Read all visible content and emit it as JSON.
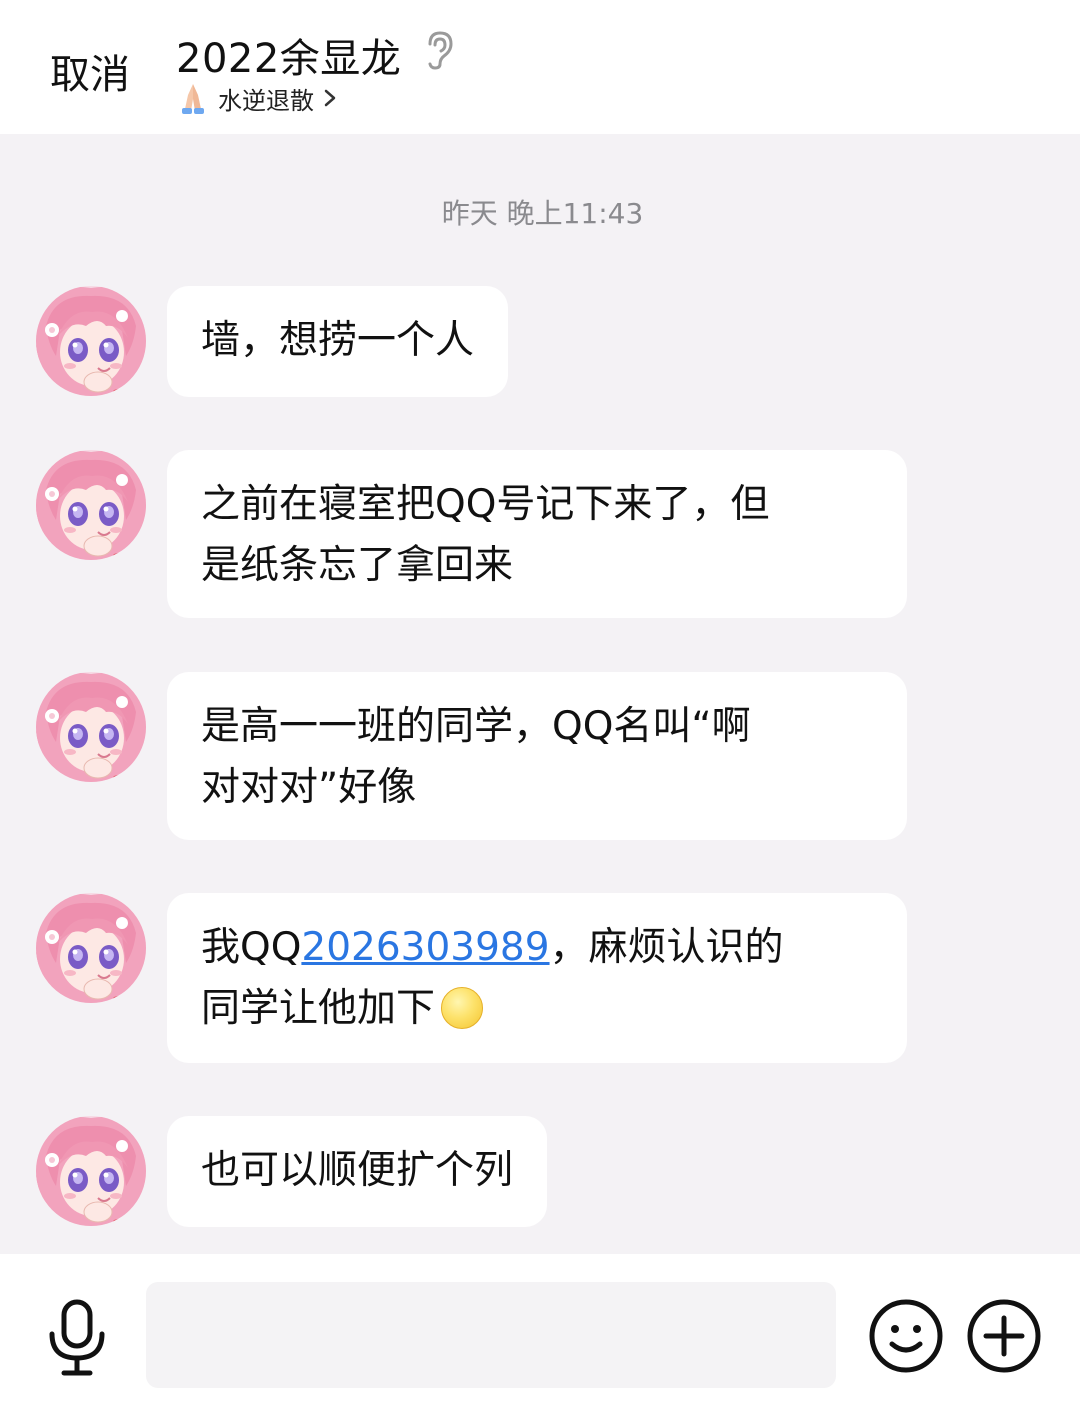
{
  "header": {
    "cancel_label": "取消",
    "title": "2022余显龙",
    "subtitle": "水逆退散"
  },
  "timestamp": "昨天 晚上11:43",
  "messages": [
    {
      "text": "墙，想捞一个人"
    },
    {
      "text": "之前在寝室把QQ号记下来了，但\n是纸条忘了拿回来"
    },
    {
      "text": "是高一一班的同学，QQ名叫“啊\n对对对”好像"
    },
    {
      "prefix": "我QQ",
      "link": "2026303989",
      "suffix": "，麻烦认识的\n同学让他加下"
    },
    {
      "text": "也可以顺便扩个列"
    }
  ],
  "footer": {
    "input_value": "",
    "input_placeholder": ""
  },
  "colors": {
    "background": "#f4f2f5",
    "bubble": "#ffffff",
    "link": "#2a76e2",
    "timestamp": "#8a8a8e"
  },
  "icons": [
    "ear-icon",
    "pray-icon",
    "chevron-right-icon",
    "microphone-icon",
    "smiley-icon",
    "plus-circle-icon",
    "sunglasses-emoji"
  ]
}
